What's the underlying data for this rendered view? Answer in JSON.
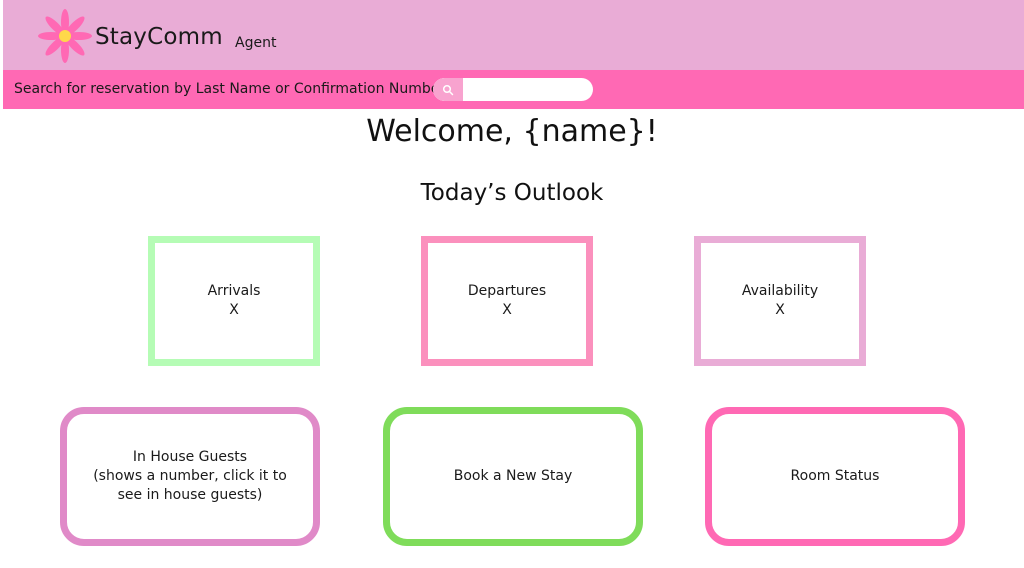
{
  "header": {
    "brand": "StayComm",
    "role": "Agent",
    "logo_icon": "flower-logo-icon"
  },
  "search": {
    "label": "Search for reservation by Last Name or Confirmation Number",
    "placeholder": "",
    "value": "",
    "icon": "search-icon"
  },
  "main": {
    "welcome": "Welcome, {name}!",
    "outlook_title": "Today’s Outlook",
    "stats": [
      {
        "label": "Arrivals",
        "value": "X"
      },
      {
        "label": "Departures",
        "value": "X"
      },
      {
        "label": "Availability",
        "value": "X"
      }
    ],
    "actions": [
      {
        "label": "In House Guests\n(shows a number, click it to see in house guests)"
      },
      {
        "label": "Book a New Stay"
      },
      {
        "label": "Room Status"
      }
    ]
  },
  "colors": {
    "header_bg": "#e9acd6",
    "search_bar_bg": "#ff69b4",
    "arrivals_border": "#b5fcb5",
    "departures_border": "#fb90bd",
    "availability_border": "#e9acd6",
    "in_house_border": "#e08ac8",
    "book_border": "#7fdc5a",
    "room_status_border": "#ff69b4"
  }
}
